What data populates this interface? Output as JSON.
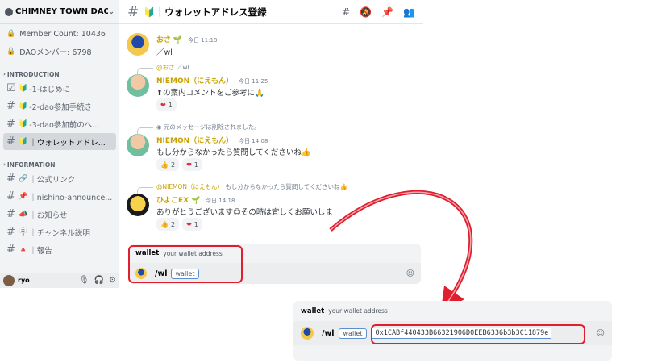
{
  "server": {
    "name": "CHIMNEY TOWN DAO"
  },
  "stats": [
    {
      "label": "Member Count: 10436"
    },
    {
      "label": "DAOメンバー: 6798"
    }
  ],
  "categories": [
    {
      "name": "INTRODUCTION",
      "channels": [
        {
          "emoji": "🔰",
          "label": "-1-はじめに",
          "icon": "check-box-icon"
        },
        {
          "emoji": "🔰",
          "label": "-2-dao参加手続き",
          "icon": "hash-icon"
        },
        {
          "emoji": "🔰",
          "label": "-3-dao参加前のへ...",
          "icon": "hash-lock-icon"
        },
        {
          "emoji": "🔰",
          "label": "｜ウォレットアドレ...",
          "icon": "hash-icon",
          "active": true
        }
      ]
    },
    {
      "name": "INFORMATION",
      "channels": [
        {
          "emoji": "🔗",
          "label": "｜公式リンク",
          "icon": "hash-icon"
        },
        {
          "emoji": "📌",
          "label": "｜nishino-announce...",
          "icon": "hash-icon"
        },
        {
          "emoji": "📣",
          "label": "｜お知らせ",
          "icon": "hash-icon"
        },
        {
          "emoji": "🪧",
          "label": "｜チャンネル説明",
          "icon": "hash-lock-icon"
        },
        {
          "emoji": "🔺",
          "label": "｜報告",
          "icon": "hash-icon"
        }
      ]
    }
  ],
  "user": {
    "name": "ryo"
  },
  "channel_header": {
    "emoji": "🔰",
    "title": "｜ウォレットアドレス登録"
  },
  "messages": [
    {
      "author": "おさ",
      "badge": "🌱",
      "time": "今日 11:18",
      "text": "／wl"
    },
    {
      "reply_author": "@おさ",
      "reply_text": "／wl",
      "author": "NIEMON（にえもん）",
      "time": "今日 11:25",
      "text_emoji": "⬆",
      "text": "の案内コメントをご参考に🙏",
      "reactions": [
        {
          "emoji": "❤",
          "count": "1"
        }
      ]
    },
    {
      "reply_text": "元のメッセージは削除されました。",
      "author": "NIEMON（にえもん）",
      "time": "今日 14:08",
      "text": "もし分からなかったら質問してくださいね👍",
      "reactions": [
        {
          "emoji": "👍",
          "count": "2"
        },
        {
          "emoji": "❤",
          "count": "1"
        }
      ]
    },
    {
      "reply_author": "@NIEMON（にえもん）",
      "reply_text": "もし分からなかったら質問してくださいね👍",
      "author": "ひよこEX",
      "badge": "🌱",
      "time": "今日 14:18",
      "text": "ありがとうございます😊その時は宜しくお願いしま",
      "reactions": [
        {
          "emoji": "👍",
          "count": "2"
        },
        {
          "emoji": "❤",
          "count": "1"
        }
      ]
    }
  ],
  "command": {
    "option_name": "wallet",
    "option_desc": "your wallet address",
    "slash": "/wl",
    "chip": "wallet",
    "value": "0x1CABf440433B66321906D0EEB6336b3b3C11879e"
  },
  "colors": {
    "highlight": "#e01e2e",
    "author": "#c9a200"
  }
}
